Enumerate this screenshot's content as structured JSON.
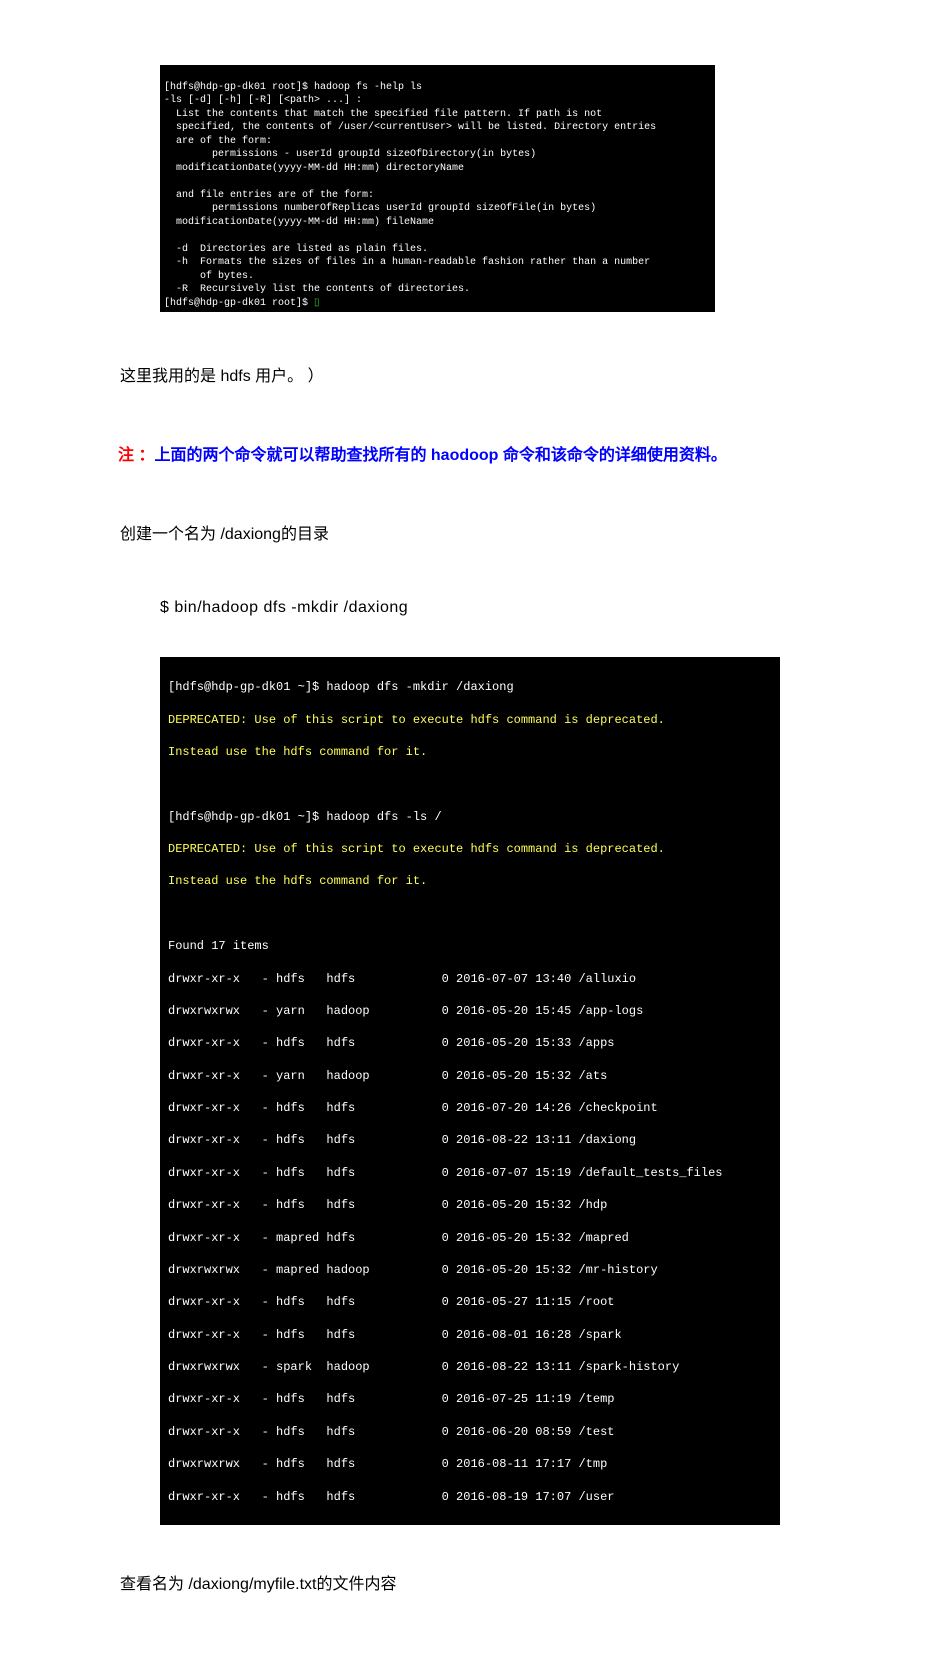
{
  "terminal1": {
    "prompt1": "[hdfs@hdp-gp-dk01 root]$ ",
    "cmd1": "hadoop fs -help ls",
    "body": "-ls [-d] [-h] [-R] [<path> ...] :\n  List the contents that match the specified file pattern. If path is not\n  specified, the contents of /user/<currentUser> will be listed. Directory entries\n  are of the form:\n  \tpermissions - userId groupId sizeOfDirectory(in bytes)\n  modificationDate(yyyy-MM-dd HH:mm) directoryName\n\n  and file entries are of the form:\n  \tpermissions numberOfReplicas userId groupId sizeOfFile(in bytes)\n  modificationDate(yyyy-MM-dd HH:mm) fileName\n\n  -d  Directories are listed as plain files.\n  -h  Formats the sizes of files in a human-readable fashion rather than a number\n      of bytes.\n  -R  Recursively list the contents of directories.",
    "prompt2": "[hdfs@hdp-gp-dk01 root]$ ",
    "cursor": "▯"
  },
  "para1": "这里我用的是 hdfs 用户。   ）",
  "note": {
    "red": "注 ：",
    "blue": "上面的两个命令就可以帮助查找所有的 haodoop 命令和该命令的详细使用资料。"
  },
  "para2": "创建一个名为  /daxiong的目录",
  "command": "$  bin/hadoop  dfs  -mkdir  /daxiong",
  "terminal2": {
    "line1": "[hdfs@hdp-gp-dk01 ~]$ hadoop dfs -mkdir /daxiong",
    "dep1a": "DEPRECATED: Use of this script to execute hdfs command is deprecated.",
    "dep1b": "Instead use the hdfs command for it.",
    "line2": "[hdfs@hdp-gp-dk01 ~]$ hadoop dfs -ls /",
    "dep2a": "DEPRECATED: Use of this script to execute hdfs command is deprecated.",
    "dep2b": "Instead use the hdfs command for it.",
    "found": "Found 17 items",
    "rows": [
      "drwxr-xr-x   - hdfs   hdfs            0 2016-07-07 13:40 /alluxio",
      "drwxrwxrwx   - yarn   hadoop          0 2016-05-20 15:45 /app-logs",
      "drwxr-xr-x   - hdfs   hdfs            0 2016-05-20 15:33 /apps",
      "drwxr-xr-x   - yarn   hadoop          0 2016-05-20 15:32 /ats",
      "drwxr-xr-x   - hdfs   hdfs            0 2016-07-20 14:26 /checkpoint",
      "drwxr-xr-x   - hdfs   hdfs            0 2016-08-22 13:11 /daxiong",
      "drwxr-xr-x   - hdfs   hdfs            0 2016-07-07 15:19 /default_tests_files",
      "drwxr-xr-x   - hdfs   hdfs            0 2016-05-20 15:32 /hdp",
      "drwxr-xr-x   - mapred hdfs            0 2016-05-20 15:32 /mapred",
      "drwxrwxrwx   - mapred hadoop          0 2016-05-20 15:32 /mr-history",
      "drwxr-xr-x   - hdfs   hdfs            0 2016-05-27 11:15 /root",
      "drwxr-xr-x   - hdfs   hdfs            0 2016-08-01 16:28 /spark",
      "drwxrwxrwx   - spark  hadoop          0 2016-08-22 13:11 /spark-history",
      "drwxr-xr-x   - hdfs   hdfs            0 2016-07-25 11:19 /temp",
      "drwxr-xr-x   - hdfs   hdfs            0 2016-06-20 08:59 /test",
      "drwxrwxrwx   - hdfs   hdfs            0 2016-08-11 17:17 /tmp",
      "drwxr-xr-x   - hdfs   hdfs            0 2016-08-19 17:07 /user"
    ]
  },
  "para3": "查看名为  /daxiong/myfile.txt的文件内容"
}
